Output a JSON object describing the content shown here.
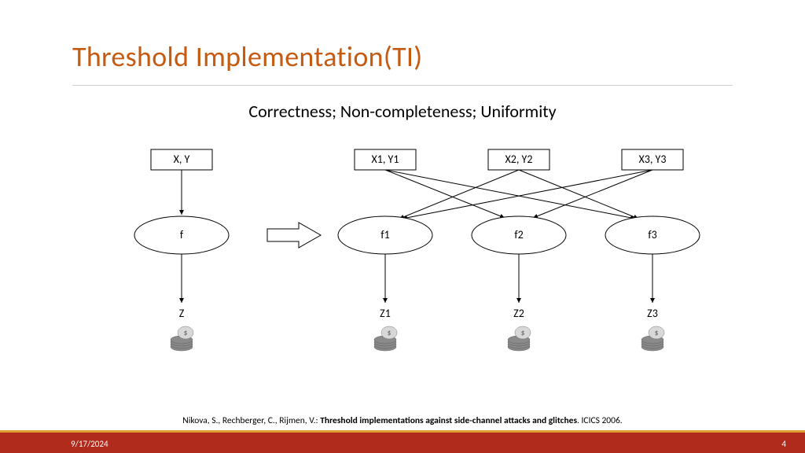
{
  "title": "Threshold Implementation(TI)",
  "subtitle": "Correctness; Non-completeness; Uniformity",
  "left": {
    "input": "X, Y",
    "func": "f",
    "output": "Z"
  },
  "right": {
    "inputs": [
      "X1, Y1",
      "X2, Y2",
      "X3, Y3"
    ],
    "funcs": [
      "f1",
      "f2",
      "f3"
    ],
    "outputs": [
      "Z1",
      "Z2",
      "Z3"
    ]
  },
  "citation_prefix": "Nikova, S., Rechberger, C., Rijmen, V.: ",
  "citation_bold": "Threshold implementations against side-channel attacks and glitches",
  "citation_suffix": ". ICICS 2006.",
  "footer": {
    "date": "9/17/2024",
    "page": "4"
  }
}
